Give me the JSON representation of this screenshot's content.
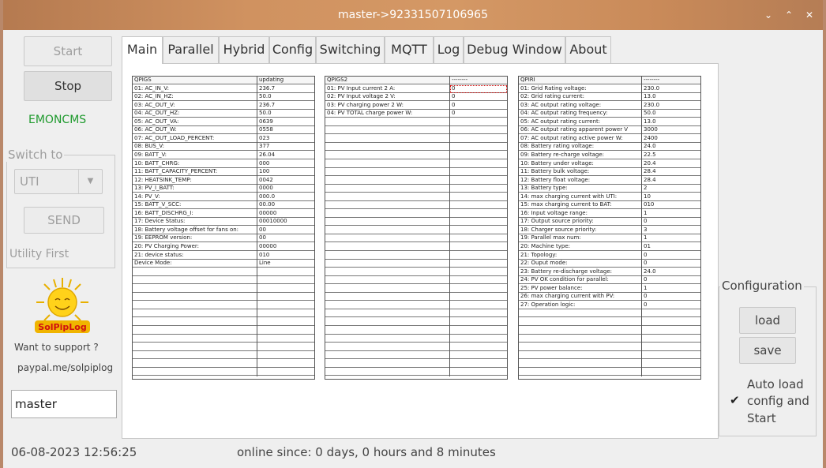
{
  "window": {
    "title": "master->92331507106965"
  },
  "sidebar": {
    "start_label": "Start",
    "stop_label": "Stop",
    "emoncms_label": "EMONCMS",
    "switch_to_label": "Switch to",
    "mode_select": "UTI",
    "send_label": "SEND",
    "priority_text": "Utility First",
    "logo_text": "SolPipLog",
    "support_text": "Want to support ?",
    "paypal_text": "paypal.me/solpiplog",
    "name_value": "master"
  },
  "tabs": [
    "Main",
    "Parallel",
    "Hybrid",
    "Config",
    "Switching",
    "MQTT",
    "Log",
    "Debug Window",
    "About"
  ],
  "qpigs": {
    "header": [
      "QPIGS",
      "updating"
    ],
    "rows": [
      [
        "01: AC_IN_V:",
        "236.7"
      ],
      [
        "02: AC_IN_HZ:",
        "50.0"
      ],
      [
        "03: AC_OUT_V:",
        "236.7"
      ],
      [
        "04: AC_OUT_HZ:",
        "50.0"
      ],
      [
        "05: AC_OUT_VA:",
        "0639"
      ],
      [
        "06: AC_OUT_W:",
        "0558"
      ],
      [
        "07: AC_OUT_LOAD_PERCENT:",
        "023"
      ],
      [
        "08: BUS_V:",
        "377"
      ],
      [
        "09: BATT_V:",
        "26.04"
      ],
      [
        "10: BATT_CHRG:",
        "000"
      ],
      [
        "11: BATT_CAPACITY_PERCENT:",
        "100"
      ],
      [
        "12: HEATSINK_TEMP:",
        "0042"
      ],
      [
        "13: PV_I_BATT:",
        "0000"
      ],
      [
        "14: PV_V:",
        "000.0"
      ],
      [
        "15: BATT_V_SCC:",
        "00.00"
      ],
      [
        "16: BATT_DISCHRG_I:",
        "00000"
      ],
      [
        "17: Device Status:",
        "00010000"
      ],
      [
        "18: Battery voltage offset for fans on:",
        "00"
      ],
      [
        "19: EEPROM version:",
        "00"
      ],
      [
        "20: PV Charging Power:",
        "00000"
      ],
      [
        "21: device status:",
        "010"
      ],
      [
        "Device Mode:",
        "Line"
      ],
      [
        "",
        ""
      ],
      [
        "",
        ""
      ],
      [
        "",
        ""
      ],
      [
        "",
        ""
      ],
      [
        "",
        ""
      ],
      [
        "",
        ""
      ],
      [
        "",
        ""
      ],
      [
        "",
        ""
      ]
    ]
  },
  "qpigs2": {
    "header": [
      "QPIGS2",
      "--------"
    ],
    "rows": [
      [
        "01: PV Input current 2 A:",
        "0"
      ],
      [
        "02: PV Input voltage 2 V:",
        "0"
      ],
      [
        "03: PV charging power 2 W:",
        "0"
      ],
      [
        "04: PV TOTAL charge power W:",
        "0"
      ]
    ]
  },
  "qpiri": {
    "header": [
      "QPIRI",
      "--------"
    ],
    "rows": [
      [
        "01: Grid Rating voltage:",
        "230.0"
      ],
      [
        "02: Grid rating current:",
        "13.0"
      ],
      [
        "03: AC output rating voltage:",
        "230.0"
      ],
      [
        "04: AC output rating frequency:",
        "50.0"
      ],
      [
        "05: AC output rating current:",
        "13.0"
      ],
      [
        "06: AC output rating apparent power V",
        "3000"
      ],
      [
        "07: AC output rating active power W:",
        "2400"
      ],
      [
        "08: Battery rating voltage:",
        "24.0"
      ],
      [
        "09: Battery re-charge voltage:",
        "22.5"
      ],
      [
        "10: Battery under voltage:",
        "20.4"
      ],
      [
        "11: Battery bulk voltage:",
        "28.4"
      ],
      [
        "12: Battery float voltage:",
        "28.4"
      ],
      [
        "13: Battery type:",
        "2"
      ],
      [
        "14: max charging current with UTI:",
        "10"
      ],
      [
        "15: max charging current to BAT:",
        "010"
      ],
      [
        "16: Input voltage range:",
        "1"
      ],
      [
        "17: Output source priority:",
        "0"
      ],
      [
        "18: Charger source priority:",
        "3"
      ],
      [
        "19: Parallel max num:",
        "1"
      ],
      [
        "20: Machine type:",
        "01"
      ],
      [
        "21: Topology:",
        "0"
      ],
      [
        "22: Ouput mode:",
        "0"
      ],
      [
        "23: Battery re-discharge voltage:",
        "24.0"
      ],
      [
        "24: PV OK condition for parallel:",
        "0"
      ],
      [
        "25: PV power balance:",
        "1"
      ],
      [
        "26: max charging current with PV:",
        "0"
      ],
      [
        "27: Operation logic:",
        "0"
      ]
    ]
  },
  "config": {
    "title": "Configuration",
    "load_label": "load",
    "save_label": "save",
    "auto_load_label_1": "Auto load",
    "auto_load_label_2": "config and",
    "auto_load_label_3": "Start",
    "auto_load_checked": "✔"
  },
  "status": {
    "datetime": "06-08-2023 12:56:25",
    "online": "online since: 0 days, 0 hours  and 8 minutes"
  }
}
